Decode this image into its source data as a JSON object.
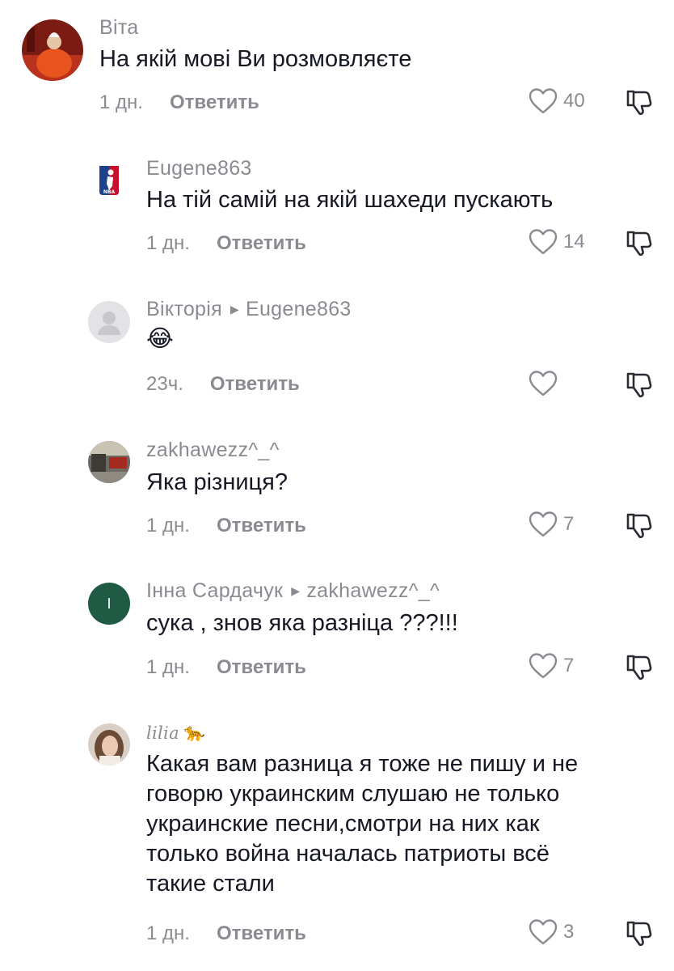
{
  "reply_label": "Ответить",
  "comments": [
    {
      "user": "Віта",
      "reply_to": "",
      "text": "На якій мові Ви розмовляєте",
      "time": "1 дн.",
      "likes": "40",
      "avatar": "photo-orange"
    },
    {
      "user": "Eugene863",
      "reply_to": "",
      "text": "На тій самій на якій шахеди пускають",
      "time": "1 дн.",
      "likes": "14",
      "avatar": "nba-logo"
    },
    {
      "user": "Вікторія",
      "reply_to": "Eugene863",
      "text": "😂",
      "time": "23ч.",
      "likes": "",
      "avatar": "default-person"
    },
    {
      "user": "zakhawezz^_^",
      "reply_to": "",
      "text": "Яка різниця?",
      "time": "1 дн.",
      "likes": "7",
      "avatar": "photo-street"
    },
    {
      "user": "Інна Сардачук",
      "reply_to": "zakhawezz^_^",
      "text": "сука , знов яка разніца ???!!!",
      "time": "1 дн.",
      "likes": "7",
      "avatar": "letter-avatar",
      "avatar_letter": "I",
      "avatar_color": "#1f5a44"
    },
    {
      "user": "lilia",
      "user_emoji": "🐆",
      "reply_to": "",
      "text_lines": [
        "Какая вам разница я тоже не пишу и не",
        "говорю украинским слушаю не только",
        "украинские песни,смотри на них как",
        "только война началась патриоты всё",
        "такие стали"
      ],
      "time": "1 дн.",
      "likes": "3",
      "avatar": "photo-girl"
    }
  ]
}
